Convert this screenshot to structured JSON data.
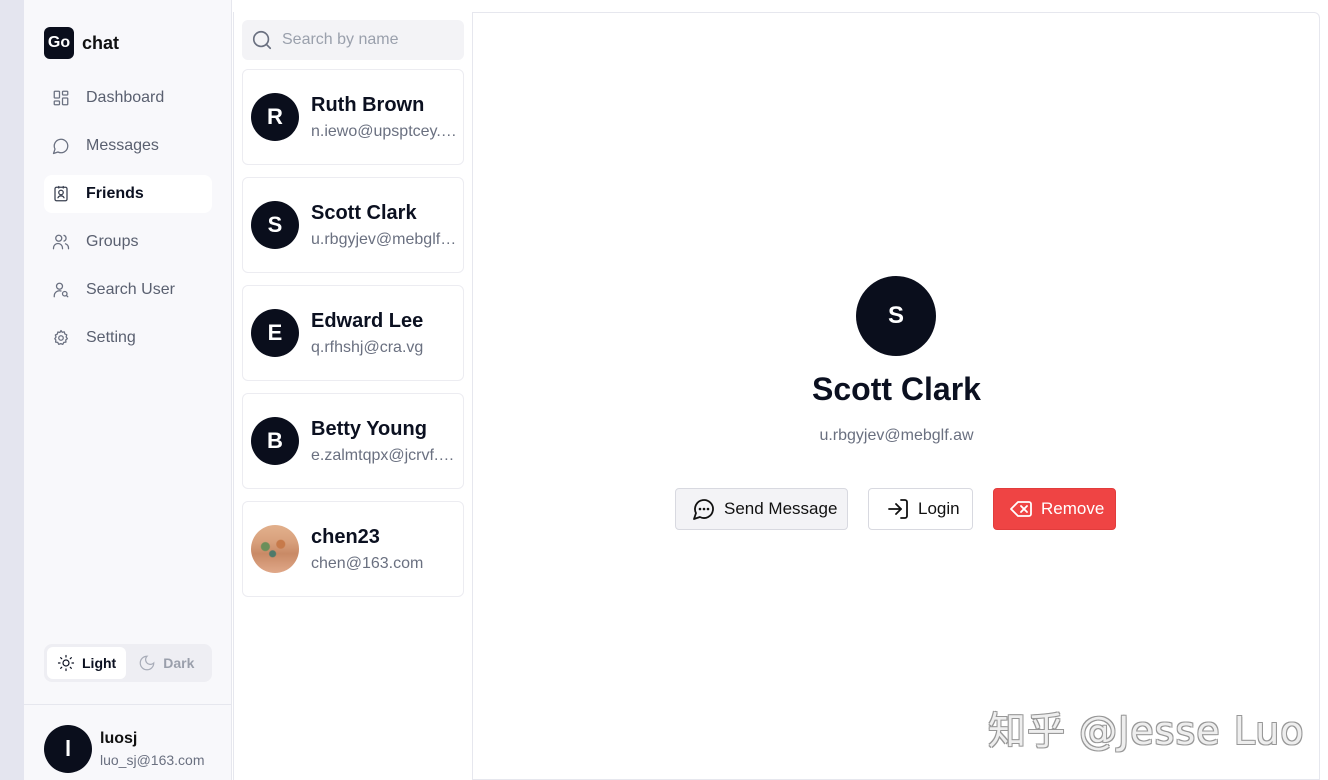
{
  "brand": {
    "badge": "Go",
    "name": "chat"
  },
  "nav": [
    {
      "label": "Dashboard",
      "icon": "dashboard-icon"
    },
    {
      "label": "Messages",
      "icon": "chat-bubble-icon"
    },
    {
      "label": "Friends",
      "icon": "contact-card-icon",
      "active": true
    },
    {
      "label": "Groups",
      "icon": "users-icon"
    },
    {
      "label": "Search User",
      "icon": "user-search-icon"
    },
    {
      "label": "Setting",
      "icon": "gear-icon"
    }
  ],
  "theme": {
    "light_label": "Light",
    "dark_label": "Dark",
    "selected": "Light"
  },
  "current_user": {
    "initial": "l",
    "name": "luosj",
    "email": "luo_sj@163.com"
  },
  "search": {
    "placeholder": "Search by name",
    "value": ""
  },
  "friends": [
    {
      "initial": "R",
      "name": "Ruth Brown",
      "email": "n.iewo@upsptcey.bz"
    },
    {
      "initial": "S",
      "name": "Scott Clark",
      "email": "u.rbgyjev@mebglf.aw"
    },
    {
      "initial": "E",
      "name": "Edward Lee",
      "email": "q.rfhshj@cra.vg"
    },
    {
      "initial": "B",
      "name": "Betty Young",
      "email": "e.zalmtqpx@jcrvf.ma"
    },
    {
      "initial": "",
      "name": "chen23",
      "email": "chen@163.com",
      "photo": true
    }
  ],
  "detail": {
    "initial": "S",
    "name": "Scott Clark",
    "email": "u.rbgyjev@mebglf.aw",
    "send_message_label": "Send Message",
    "login_label": "Login",
    "remove_label": "Remove"
  },
  "watermark": "知乎 @Jesse Luo",
  "colors": {
    "accent_dark": "#0a0e1c",
    "danger": "#ef4444",
    "background": "#e4e5ef"
  }
}
